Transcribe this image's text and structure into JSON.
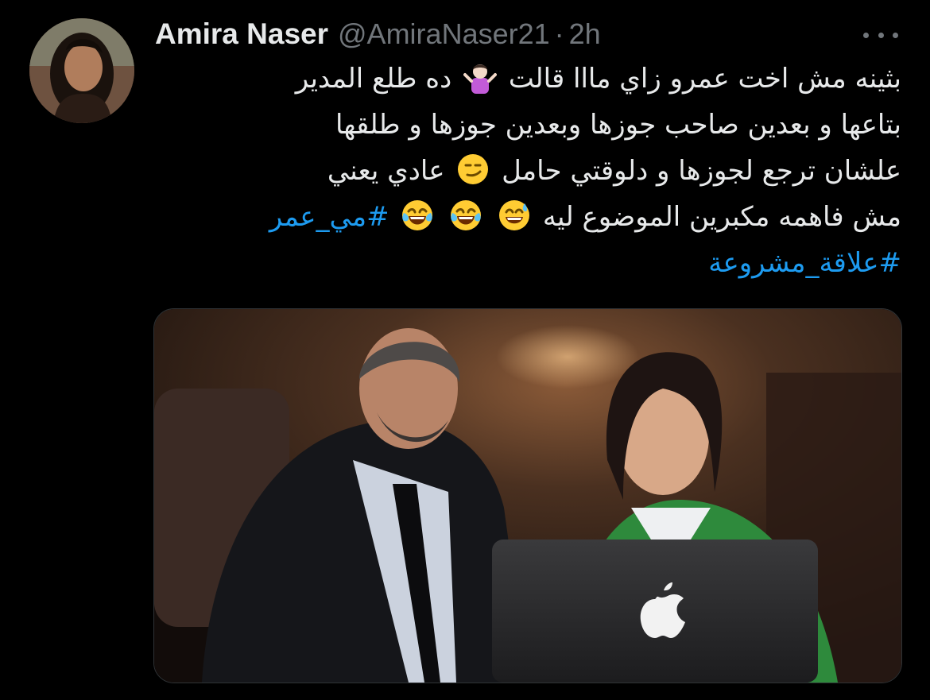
{
  "tweet": {
    "author_name": "Amira Naser",
    "handle": "@AmiraNaser21",
    "separator": "·",
    "time": "2h",
    "more_icon": "ellipsis-icon",
    "avatar_icon": "avatar-photo",
    "lines": [
      "بثينه مش اخت عمرو زاي مااا قالت",
      "ده طلع المدير",
      "بتاعها و بعدين صاحب جوزها وبعدين جوزها و طلقها",
      "علشان ترجع لجوزها و دلوقتي حامل",
      "عادي يعني",
      "مش فاهمه مكبرين الموضوع ليه"
    ],
    "hashtags": [
      "#مي_عمر",
      "#علاقة_مشروعة"
    ],
    "emojis": [
      "person-shrugging",
      "smirking-face",
      "grinning-sweat-face",
      "tears-of-joy-face",
      "tears-of-joy-face"
    ],
    "media": {
      "description_icon": "tv-still-image",
      "colors": {
        "accent": "#1d9bf0",
        "muted": "#71767b",
        "text": "#e7e9ea",
        "bg": "#000000"
      }
    }
  }
}
